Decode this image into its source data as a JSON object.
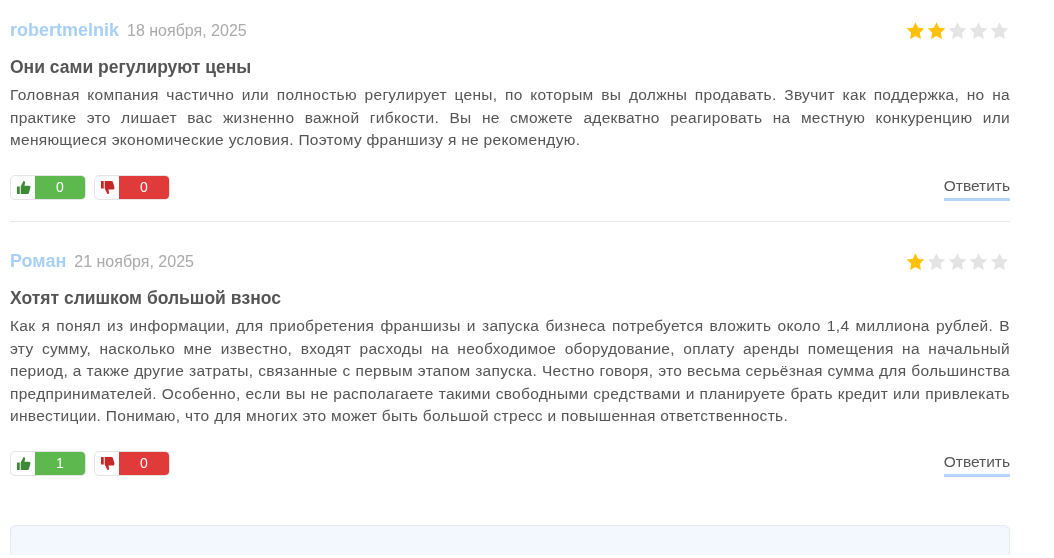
{
  "reviews": [
    {
      "author": "robertmelnik",
      "date": "18 ноября, 2025",
      "stars": 2,
      "title": "Они сами регулируют цены",
      "text": "Головная компания частично или полностью регулирует цены, по которым вы должны продавать. Звучит как поддержка, но на практике это лишает вас жизненно важной гибкости. Вы не сможете адекватно реагировать на местную конкуренцию или меняющиеся экономические условия. Поэтому франшизу я не рекомендую.",
      "likes": "0",
      "dislikes": "0",
      "reply": "Ответить"
    },
    {
      "author": "Роман",
      "date": "21 ноября, 2025",
      "stars": 1,
      "title": "Хотят слишком большой взнос",
      "text": "Как я понял из информации, для приобретения франшизы и запуска бизнеса потребуется вложить около 1,4 миллиона рублей. В эту сумму, насколько мне известно, входят расходы на необходимое оборудование, оплату аренды помещения на начальный период, а также другие затраты, связанные с первым этапом запуска. Честно говоря, это весьма серьёзная сумма для большинства предпринимателей. Особенно, если вы не располагаете такими свободными средствами и планируете брать кредит или привлекать инвестиции. Понимаю, что для многих это может быть большой стресс и повышенная ответственность.",
      "likes": "1",
      "dislikes": "0",
      "reply": "Ответить"
    }
  ]
}
